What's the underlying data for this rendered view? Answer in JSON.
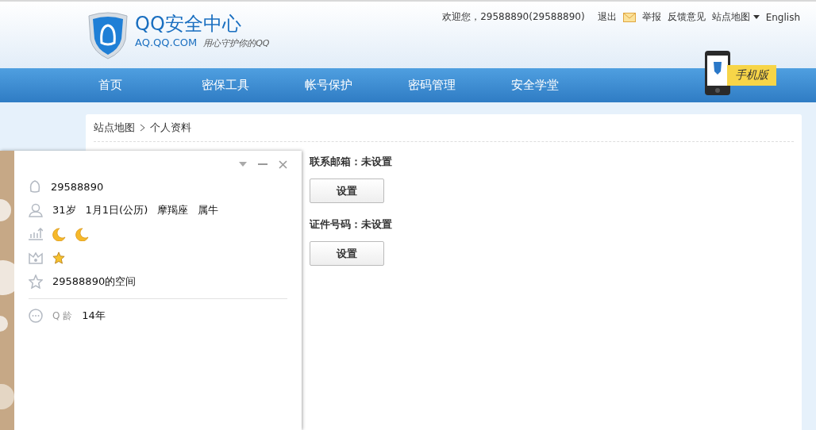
{
  "header": {
    "logo_title": "QQ安全中心",
    "logo_domain": "AQ.QQ.COM",
    "logo_slogan": "用心守护你的QQ",
    "top_links": [
      {
        "kind": "text",
        "label": "欢迎您，29588890(29588890)"
      },
      {
        "kind": "link",
        "label": "退出"
      },
      {
        "kind": "mail"
      },
      {
        "kind": "link",
        "label": "举报"
      },
      {
        "kind": "link",
        "label": "反馈意见"
      },
      {
        "kind": "dropdown",
        "label": "站点地图"
      },
      {
        "kind": "link",
        "label": "English"
      }
    ],
    "mobile_badge": "手机版"
  },
  "nav": [
    "首页",
    "密保工具",
    "帐号保护",
    "密码管理",
    "安全学堂"
  ],
  "breadcrumb": [
    "站点地图",
    "个人资料"
  ],
  "fields": [
    {
      "label": "联系邮箱：未设置",
      "button": "设置"
    },
    {
      "label": "证件号码：未设置",
      "button": "设置"
    }
  ],
  "profile_card": {
    "rows": [
      {
        "kind": "text",
        "texts": [
          "29588890"
        ]
      },
      {
        "kind": "text",
        "texts": [
          "31岁",
          "1月1日(公历)",
          "摩羯座",
          "属牛"
        ]
      },
      {
        "kind": "badges",
        "badges": [
          {
            "kind": "moon"
          },
          {
            "kind": "moon"
          }
        ]
      },
      {
        "kind": "badges",
        "badges": [
          {
            "kind": "star"
          }
        ]
      },
      {
        "kind": "text",
        "texts": [
          "29588890的空间"
        ]
      },
      {
        "kind": "age",
        "label": "Q 龄",
        "texts": [
          "14年"
        ]
      }
    ]
  }
}
